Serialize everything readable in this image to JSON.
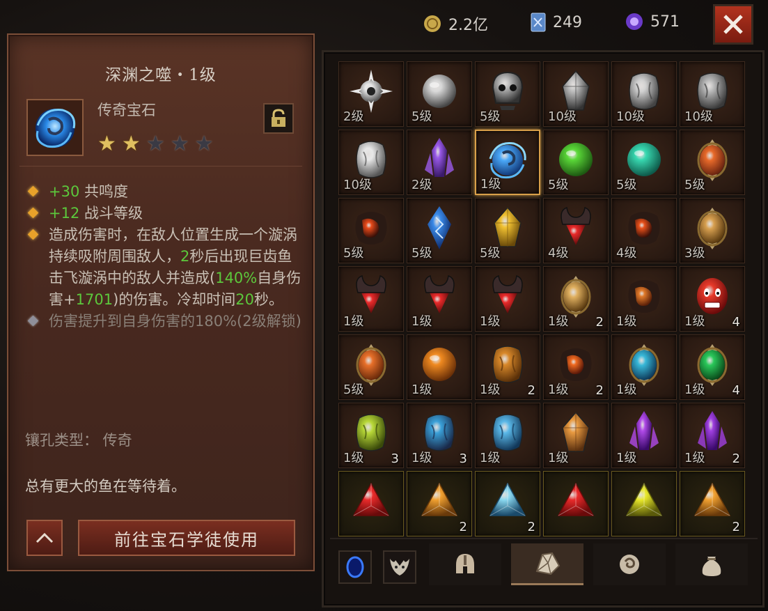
{
  "currency": [
    {
      "name": "gold",
      "icon": "gold-coin-icon",
      "value": "2.2亿",
      "color": "#c8a84a"
    },
    {
      "name": "scroll",
      "icon": "blue-card-icon",
      "value": "249",
      "color": "#7aa0d8"
    },
    {
      "name": "orb",
      "icon": "purple-orb-icon",
      "value": "571",
      "color": "#8a5ad8"
    }
  ],
  "detail": {
    "title": "深渊之噬・1级",
    "type": "传奇宝石",
    "stars_total": 5,
    "stars_filled": 2,
    "effects": [
      {
        "prefix": "+30",
        "text": " 共鸣度"
      },
      {
        "prefix": "+12",
        "text": " 战斗等级"
      }
    ],
    "desc_parts": [
      "造成伤害时，在敌人位置生成一个漩涡持续吸附周围敌人，",
      "2",
      "秒后出现巨齿鱼击飞漩涡中的敌人并造成(",
      "140%",
      "自身伤害+",
      "1701",
      ")的伤害。冷却时间",
      "20",
      "秒。"
    ],
    "locked_effect": "伤害提升到自身伤害的180%(2级解锁)",
    "socket": "镶孔类型：  传奇",
    "flavor": "总有更大的鱼在等待着。",
    "goto_label": "前往宝石学徒使用"
  },
  "grid": [
    {
      "lvl": "2级",
      "qty": "",
      "gem": "spiky",
      "c1": "#e8e8e8",
      "c2": "#555"
    },
    {
      "lvl": "5级",
      "qty": "",
      "gem": "orb",
      "c1": "#d8d8d8",
      "c2": "#444"
    },
    {
      "lvl": "5级",
      "qty": "",
      "gem": "skull",
      "c1": "#bbbbbb",
      "c2": "#333"
    },
    {
      "lvl": "10级",
      "qty": "",
      "gem": "shard",
      "c1": "#c0c0c0",
      "c2": "#333"
    },
    {
      "lvl": "10级",
      "qty": "",
      "gem": "rock",
      "c1": "#d0d0d0",
      "c2": "#444"
    },
    {
      "lvl": "10级",
      "qty": "",
      "gem": "rock",
      "c1": "#b8b8b8",
      "c2": "#3a3a3a"
    },
    {
      "lvl": "10级",
      "qty": "",
      "gem": "rock",
      "c1": "#e8e8e8",
      "c2": "#555"
    },
    {
      "lvl": "2级",
      "qty": "",
      "gem": "crystal",
      "c1": "#9a5ae8",
      "c2": "#3a1a6a"
    },
    {
      "lvl": "1级",
      "qty": "",
      "gem": "swirl",
      "c1": "#4aa8f8",
      "c2": "#123a7a",
      "selected": true
    },
    {
      "lvl": "5级",
      "qty": "",
      "gem": "orb",
      "c1": "#5ad838",
      "c2": "#1e5a12"
    },
    {
      "lvl": "5级",
      "qty": "",
      "gem": "orb",
      "c1": "#38d8b0",
      "c2": "#0e5a4a"
    },
    {
      "lvl": "5级",
      "qty": "",
      "gem": "ornate",
      "c1": "#e86a2a",
      "c2": "#6a2410"
    },
    {
      "lvl": "5级",
      "qty": "",
      "gem": "lava",
      "c1": "#e84a1a",
      "c2": "#3a1008"
    },
    {
      "lvl": "5级",
      "qty": "",
      "gem": "rune",
      "c1": "#3a8ae8",
      "c2": "#0e2a6a"
    },
    {
      "lvl": "5级",
      "qty": "",
      "gem": "shard",
      "c1": "#f0c030",
      "c2": "#6a4a0a"
    },
    {
      "lvl": "4级",
      "qty": "",
      "gem": "horn",
      "c1": "#e82a2a",
      "c2": "#5a0a0a"
    },
    {
      "lvl": "4级",
      "qty": "",
      "gem": "lava",
      "c1": "#e8501a",
      "c2": "#3a1008"
    },
    {
      "lvl": "3级",
      "qty": "",
      "gem": "ornate",
      "c1": "#d8a050",
      "c2": "#5a3a10"
    },
    {
      "lvl": "1级",
      "qty": "",
      "gem": "horn",
      "c1": "#e82a2a",
      "c2": "#5a0a0a"
    },
    {
      "lvl": "1级",
      "qty": "",
      "gem": "horn",
      "c1": "#e82a2a",
      "c2": "#5a0a0a"
    },
    {
      "lvl": "1级",
      "qty": "",
      "gem": "horn",
      "c1": "#e82a2a",
      "c2": "#5a0a0a"
    },
    {
      "lvl": "1级",
      "qty": "2",
      "gem": "ornate",
      "c1": "#e0b060",
      "c2": "#5a3a10"
    },
    {
      "lvl": "1级",
      "qty": "",
      "gem": "lava",
      "c1": "#e07a2a",
      "c2": "#5a2008"
    },
    {
      "lvl": "1级",
      "qty": "4",
      "gem": "face",
      "c1": "#e83a2a",
      "c2": "#6a0a0a"
    },
    {
      "lvl": "5级",
      "qty": "",
      "gem": "ornate",
      "c1": "#e8702a",
      "c2": "#6a2a0a"
    },
    {
      "lvl": "1级",
      "qty": "",
      "gem": "orb",
      "c1": "#f08a20",
      "c2": "#6a3008"
    },
    {
      "lvl": "1级",
      "qty": "2",
      "gem": "rock",
      "c1": "#d8882a",
      "c2": "#5a3008"
    },
    {
      "lvl": "1级",
      "qty": "2",
      "gem": "lava",
      "c1": "#f06a20",
      "c2": "#5a1808"
    },
    {
      "lvl": "1级",
      "qty": "",
      "gem": "ornate",
      "c1": "#38b8d8",
      "c2": "#0e3a5a"
    },
    {
      "lvl": "1级",
      "qty": "4",
      "gem": "ornate",
      "c1": "#2ac85a",
      "c2": "#0a4a1a"
    },
    {
      "lvl": "1级",
      "qty": "3",
      "gem": "rock",
      "c1": "#b8d838",
      "c2": "#3a4a0a"
    },
    {
      "lvl": "1级",
      "qty": "3",
      "gem": "rock",
      "c1": "#3aa0d8",
      "c2": "#1a2a4a"
    },
    {
      "lvl": "1级",
      "qty": "",
      "gem": "rock",
      "c1": "#5ab8e8",
      "c2": "#12385a"
    },
    {
      "lvl": "1级",
      "qty": "",
      "gem": "shard",
      "c1": "#e89a40",
      "c2": "#5a3010"
    },
    {
      "lvl": "1级",
      "qty": "",
      "gem": "crystal",
      "c1": "#b04ae8",
      "c2": "#3a0a6a"
    },
    {
      "lvl": "1级",
      "qty": "2",
      "gem": "crystal",
      "c1": "#a040e0",
      "c2": "#3a0a6a"
    },
    {
      "lvl": "",
      "qty": "",
      "gem": "tri",
      "c1": "#e82a2a",
      "c2": "#6a0a0a",
      "gold": true
    },
    {
      "lvl": "",
      "qty": "2",
      "gem": "tri",
      "c1": "#f0a030",
      "c2": "#6a3a0a",
      "gold": true
    },
    {
      "lvl": "",
      "qty": "2",
      "gem": "tri",
      "c1": "#8ad8f0",
      "c2": "#1a4a6a",
      "gold": true
    },
    {
      "lvl": "",
      "qty": "",
      "gem": "tri",
      "c1": "#e82a2a",
      "c2": "#6a0a0a",
      "gold": true
    },
    {
      "lvl": "",
      "qty": "",
      "gem": "tri",
      "c1": "#e8e82a",
      "c2": "#5a5a0a",
      "gold": true
    },
    {
      "lvl": "",
      "qty": "2",
      "gem": "tri",
      "c1": "#f0a030",
      "c2": "#6a3a0a",
      "gold": true
    }
  ],
  "tabs": [
    {
      "name": "tab-portal",
      "icon": "portal-icon"
    },
    {
      "name": "tab-helm-shield",
      "icon": "demon-crest-icon"
    },
    {
      "name": "tab-equipment",
      "icon": "helmet-icon"
    },
    {
      "name": "tab-gems",
      "icon": "gem-bag-icon",
      "active": true
    },
    {
      "name": "tab-materials",
      "icon": "swirl-stone-icon"
    },
    {
      "name": "tab-bag",
      "icon": "sack-icon"
    }
  ]
}
